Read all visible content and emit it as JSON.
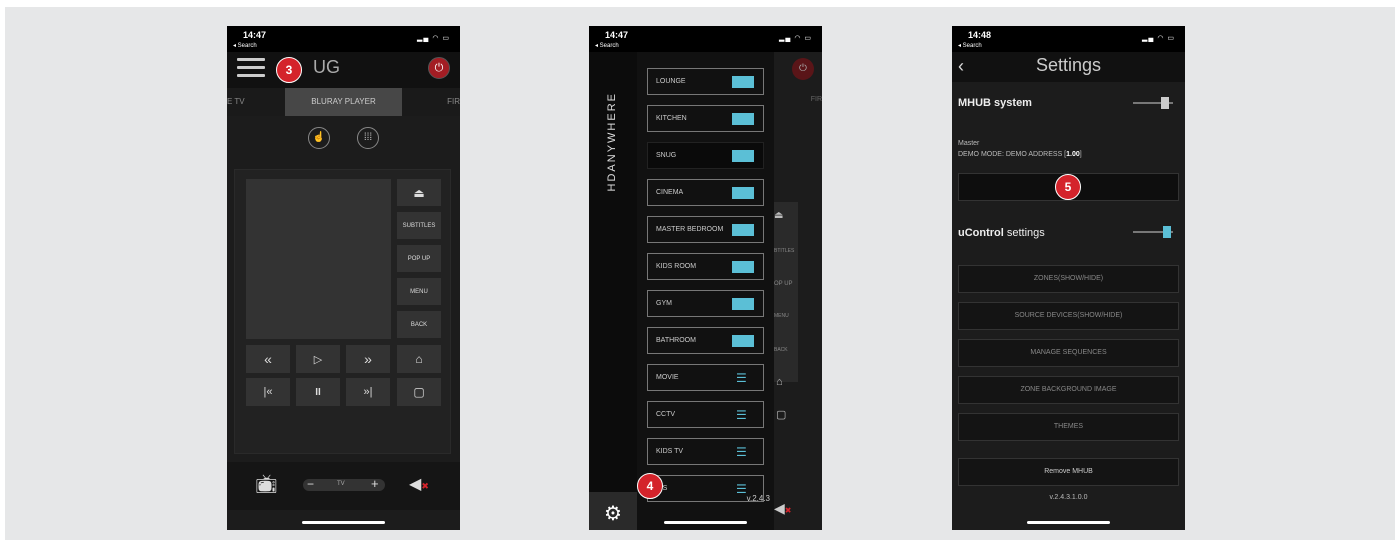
{
  "phone1": {
    "status": {
      "time": "14:47",
      "back": "◂ Search"
    },
    "title": "UG",
    "badge": "3",
    "tabs": {
      "left": "E TV",
      "active": "BLURAY PLAYER",
      "right": "FIR"
    },
    "remote": {
      "eject": "⏏",
      "subtitles": "SUBTITLES",
      "popup": "POP UP",
      "menu": "MENU",
      "back": "BACK",
      "rewind": "«",
      "play": "▷",
      "forward": "»",
      "prev": "|«",
      "pause": "II",
      "next": "»|",
      "stop": "▢"
    },
    "bottom": {
      "minus": "−",
      "vol_label": "TV",
      "plus": "+"
    }
  },
  "phone2": {
    "status": {
      "time": "14:47",
      "back": "◂ Search"
    },
    "brand": "HDANYWHERE",
    "zones": [
      {
        "label": "LOUNGE",
        "kind": "toggle"
      },
      {
        "label": "KITCHEN",
        "kind": "toggle"
      },
      {
        "label": "SNUG",
        "kind": "toggle"
      },
      {
        "label": "CINEMA",
        "kind": "toggle"
      },
      {
        "label": "MASTER BEDROOM",
        "kind": "toggle"
      },
      {
        "label": "KIDS ROOM",
        "kind": "toggle"
      },
      {
        "label": "GYM",
        "kind": "toggle"
      },
      {
        "label": "BATHROOM",
        "kind": "toggle"
      },
      {
        "label": "MOVIE",
        "kind": "list"
      },
      {
        "label": "CCTV",
        "kind": "list"
      },
      {
        "label": "KIDS TV",
        "kind": "list"
      },
      {
        "label": "WS",
        "kind": "list"
      }
    ],
    "badge": "4",
    "version": "v.2.4.3",
    "behind": {
      "tab": "FIR",
      "subtitles": "BTITLES",
      "popup": "OP UP",
      "menu": "MENU",
      "back": "BACK"
    }
  },
  "phone3": {
    "status": {
      "time": "14:48",
      "back": "◂ Search"
    },
    "title": "Settings",
    "mhub_heading": "MHUB system",
    "master_label": "Master",
    "demo_prefix": "DEMO MODE: DEMO ADDRESS [",
    "demo_value": "1.00",
    "demo_suffix": "]",
    "badge": "5",
    "ucontrol_bold": "uControl",
    "ucontrol_rest": " settings",
    "buttons": [
      "ZONES(SHOW/HIDE)",
      "SOURCE DEVICES(SHOW/HIDE)",
      "MANAGE SEQUENCES",
      "ZONE BACKGROUND IMAGE",
      "THEMES"
    ],
    "remove": "Remove MHUB",
    "version": "v.2.4.3.1.0.0"
  },
  "colors": {
    "badge": "#d4232b",
    "toggle": "#5bbfd6",
    "power": "#a31d24"
  }
}
